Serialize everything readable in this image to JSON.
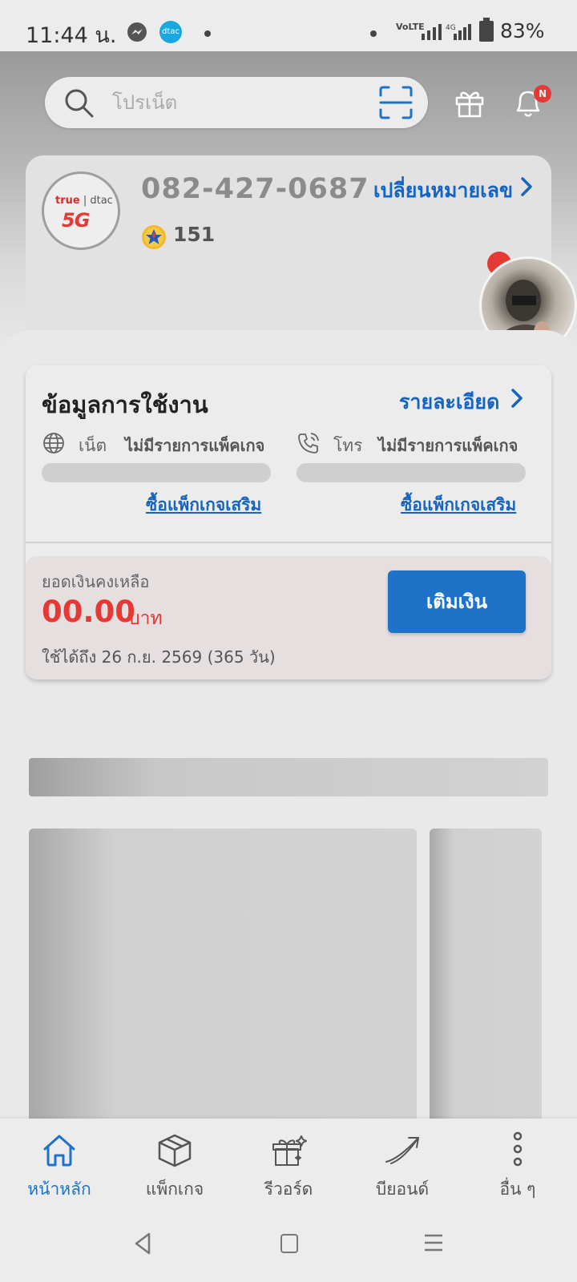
{
  "status_bar": {
    "time": "11:44 น.",
    "volte": "VoLTE",
    "battery": "83%"
  },
  "search": {
    "placeholder": "โปรเน็ต"
  },
  "header": {
    "notification_badge": "N"
  },
  "account": {
    "logo_brand": "true",
    "logo_sub": "dtac",
    "logo_5g": "5G",
    "phone_number": "082-427-0687",
    "change_number_label": "เปลี่ยนหมายเลข",
    "points": "151"
  },
  "usage": {
    "title": "ข้อมูลการใช้งาน",
    "details_link": "รายละเอียด",
    "net_label": "เน็ต",
    "net_status": "ไม่มีรายการแพ็คเกจ",
    "call_label": "โทร",
    "call_status": "ไม่มีรายการแพ็คเกจ",
    "buy_addon_net": "ซื้อแพ็กเกจเสริม",
    "buy_addon_call": "ซื้อแพ็กเกจเสริม"
  },
  "balance": {
    "label": "ยอดเงินคงเหลือ",
    "amount": "00.00",
    "unit": "บาท",
    "valid_until": "ใช้ได้ถึง 26 ก.ย. 2569 (365 วัน)",
    "topup_label": "เติมเงิน"
  },
  "tabs": [
    {
      "label": "หน้าหลัก",
      "icon": "home-icon",
      "active": true
    },
    {
      "label": "แพ็กเกจ",
      "icon": "box-icon",
      "active": false
    },
    {
      "label": "รีวอร์ด",
      "icon": "reward-gift-icon",
      "active": false
    },
    {
      "label": "บียอนด์",
      "icon": "beyond-icon",
      "active": false
    },
    {
      "label": "อื่น ๆ",
      "icon": "more-dots-icon",
      "active": false
    }
  ],
  "colors": {
    "accent_blue": "#1e73c9",
    "link_blue": "#1565c0",
    "balance_red": "#e53935"
  }
}
